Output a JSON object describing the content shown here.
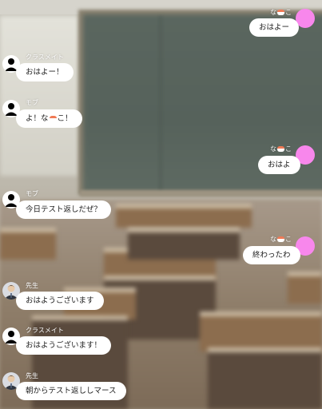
{
  "colors": {
    "bubble_bg": "#ffffff",
    "self_avatar": "#f887ec",
    "name_text": "#ffffff"
  },
  "messages": [
    {
      "side": "right",
      "sender": "なこ",
      "text": "おはよー",
      "avatar": "pink-circle-avatar"
    },
    {
      "side": "left",
      "sender": "クラスメイト",
      "text": "おはよー！",
      "avatar": "person-icon"
    },
    {
      "side": "left",
      "sender": "モブ",
      "text_before": "よ！な",
      "text_after": "こ！",
      "avatar": "person-icon"
    },
    {
      "side": "right",
      "sender": "なこ",
      "text": "おはよ",
      "avatar": "pink-circle-avatar"
    },
    {
      "side": "left",
      "sender": "モブ",
      "text": "今日テスト返しだぜ？",
      "avatar": "person-icon"
    },
    {
      "side": "right",
      "sender": "なこ",
      "text": "終わったわ",
      "avatar": "pink-circle-avatar"
    },
    {
      "side": "left",
      "sender": "先生",
      "text": "おはようございます",
      "avatar": "teacher-avatar"
    },
    {
      "side": "left",
      "sender": "クラスメイト",
      "text": "おはようございます！",
      "avatar": "person-icon"
    },
    {
      "side": "left",
      "sender": "先生",
      "text": "朝からテスト返ししマース",
      "avatar": "teacher-avatar"
    }
  ],
  "sender_split": {
    "prefix": "な",
    "suffix": "こ"
  }
}
